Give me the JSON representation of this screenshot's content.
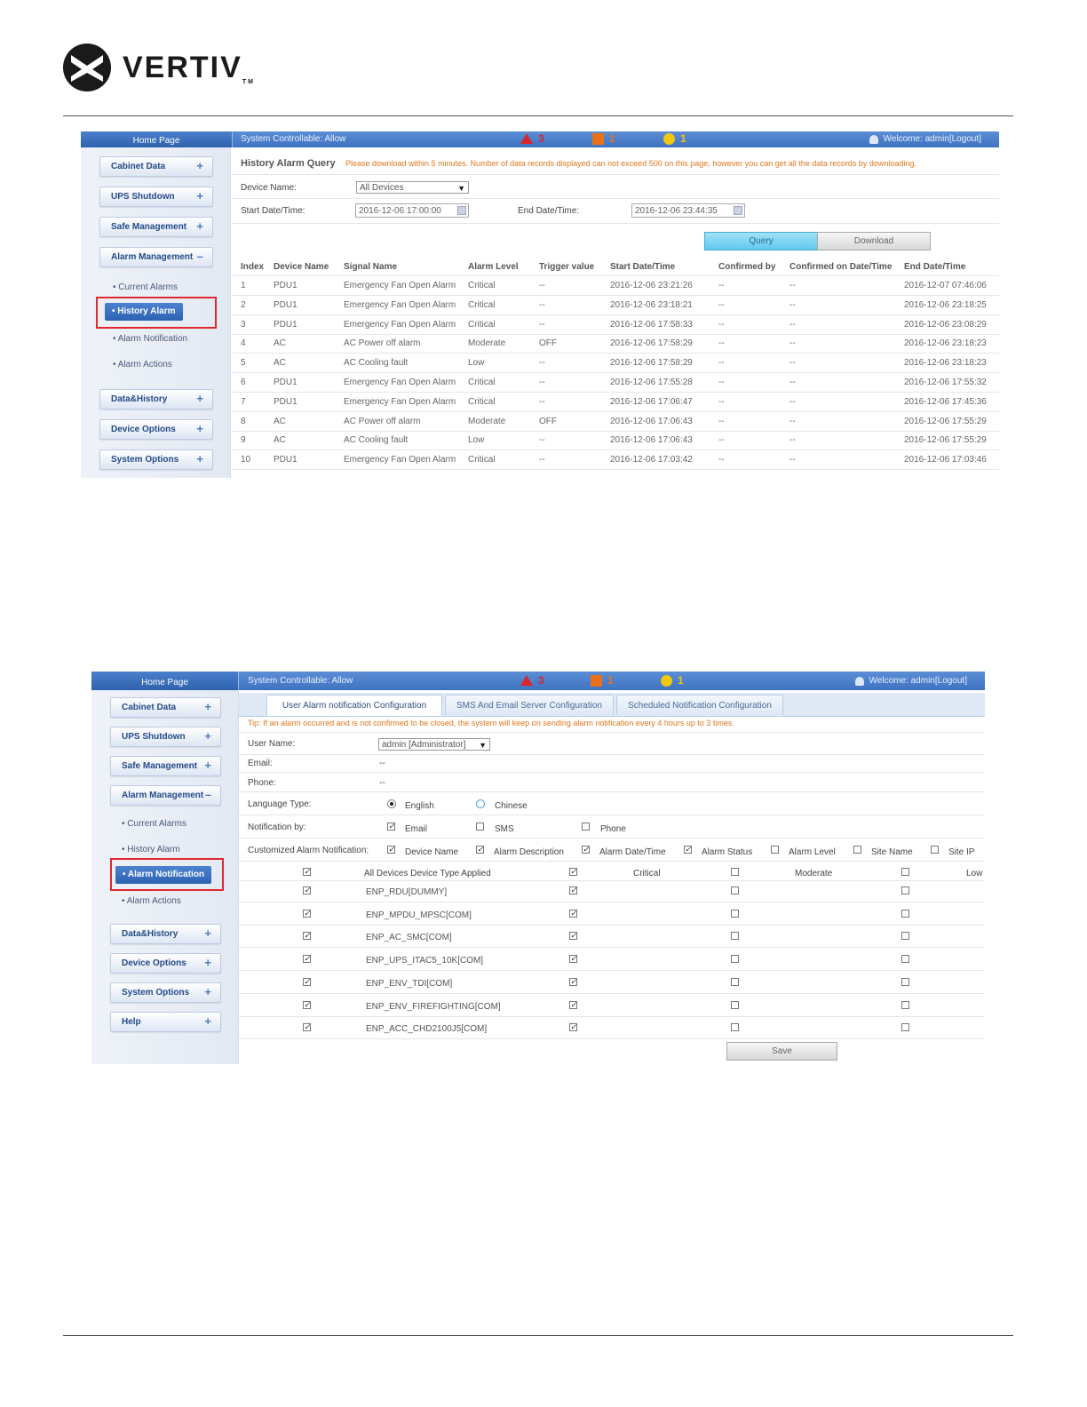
{
  "brand": {
    "name": "VERTIV",
    "tm": "TM"
  },
  "shot1": {
    "home": "Home Page",
    "system_controllable": "System Controllable:  Allow",
    "alarm_counts": {
      "critical": "3",
      "major": "1",
      "minor": "1"
    },
    "welcome": "Welcome: admin[Logout]",
    "nav": {
      "cabinet_data": "Cabinet Data",
      "ups_shutdown": "UPS Shutdown",
      "safe_management": "Safe Management",
      "alarm_management": "Alarm Management",
      "current_alarms": "Current Alarms",
      "history_alarm": "History Alarm",
      "alarm_notification": "Alarm Notification",
      "alarm_actions": "Alarm Actions",
      "data_history": "Data&History",
      "device_options": "Device Options",
      "system_options": "System Options"
    },
    "title": "History Alarm Query",
    "notice": "Please download within 5 minutes. Number of data records displayed can not exceed 500 on this page, however you can get all the data records by downloading.",
    "device_name_label": "Device Name:",
    "device_name_value": "All Devices",
    "start_label": "Start Date/Time:",
    "start_value": "2016-12-06 17:00:00",
    "end_label": "End Date/Time:",
    "end_value": "2016-12-06 23:44:35",
    "query": "Query",
    "download": "Download",
    "columns": [
      "Index",
      "Device Name",
      "Signal Name",
      "Alarm Level",
      "Trigger value",
      "Start Date/Time",
      "Confirmed by",
      "Confirmed on Date/Time",
      "End Date/Time"
    ],
    "rows": [
      [
        "1",
        "PDU1",
        "Emergency Fan Open Alarm",
        "Critical",
        "--",
        "2016-12-06 23:21:26",
        "--",
        "--",
        "2016-12-07 07:46:06"
      ],
      [
        "2",
        "PDU1",
        "Emergency Fan Open Alarm",
        "Critical",
        "--",
        "2016-12-06 23:18:21",
        "--",
        "--",
        "2016-12-06 23:18:25"
      ],
      [
        "3",
        "PDU1",
        "Emergency Fan Open Alarm",
        "Critical",
        "--",
        "2016-12-06 17:58:33",
        "--",
        "--",
        "2016-12-06 23:08:29"
      ],
      [
        "4",
        "AC",
        "AC Power off alarm",
        "Moderate",
        "OFF",
        "2016-12-06 17:58:29",
        "--",
        "--",
        "2016-12-06 23:18:23"
      ],
      [
        "5",
        "AC",
        "AC Cooling fault",
        "Low",
        "--",
        "2016-12-06 17:58:29",
        "--",
        "--",
        "2016-12-06 23:18:23"
      ],
      [
        "6",
        "PDU1",
        "Emergency Fan Open Alarm",
        "Critical",
        "--",
        "2016-12-06 17:55:28",
        "--",
        "--",
        "2016-12-06 17:55:32"
      ],
      [
        "7",
        "PDU1",
        "Emergency Fan Open Alarm",
        "Critical",
        "--",
        "2016-12-06 17:06:47",
        "--",
        "--",
        "2016-12-06 17:45:36"
      ],
      [
        "8",
        "AC",
        "AC Power off alarm",
        "Moderate",
        "OFF",
        "2016-12-06 17:06:43",
        "--",
        "--",
        "2016-12-06 17:55:29"
      ],
      [
        "9",
        "AC",
        "AC Cooling fault",
        "Low",
        "--",
        "2016-12-06 17:06:43",
        "--",
        "--",
        "2016-12-06 17:55:29"
      ],
      [
        "10",
        "PDU1",
        "Emergency Fan Open Alarm",
        "Critical",
        "--",
        "2016-12-06 17:03:42",
        "--",
        "--",
        "2016-12-06 17:03:46"
      ]
    ]
  },
  "shot2": {
    "home": "Home Page",
    "system_controllable": "System Controllable:  Allow",
    "alarm_counts": {
      "critical": "3",
      "major": "1",
      "minor": "1"
    },
    "welcome": "Welcome: admin[Logout]",
    "nav": {
      "cabinet_data": "Cabinet Data",
      "ups_shutdown": "UPS Shutdown",
      "safe_management": "Safe Management",
      "alarm_management": "Alarm Management",
      "current_alarms": "Current Alarms",
      "history_alarm": "History Alarm",
      "alarm_notification": "Alarm Notification",
      "alarm_actions": "Alarm Actions",
      "data_history": "Data&History",
      "device_options": "Device Options",
      "system_options": "System Options",
      "help": "Help"
    },
    "tabs": [
      "User Alarm notification Configuration",
      "SMS And Email Server Configuration",
      "Scheduled Notification Configuration"
    ],
    "tip": "Tip: If an alarm occurred and is not confirmed to be closed, the system will keep on sending alarm notification every 4 hours up to 3 times.",
    "user_name_label": "User Name:",
    "user_name_value": "admin [Administrator]",
    "email_label": "Email:",
    "email_value": "--",
    "phone_label": "Phone:",
    "phone_value": "--",
    "language_label": "Language Type:",
    "lang_english": "English",
    "lang_chinese": "Chinese",
    "notify_label": "Notification by:",
    "notify_email": "Email",
    "notify_sms": "SMS",
    "notify_phone": "Phone",
    "custom_label": "Customized Alarm Notification:",
    "custom_fields": [
      "Device Name",
      "Alarm Description",
      "Alarm Date/Time",
      "Alarm Status",
      "Alarm Level",
      "Site Name",
      "Site IP"
    ],
    "grid_header": {
      "devices": "All Devices Device Type Applied",
      "critical": "Critical",
      "moderate": "Moderate",
      "low": "Low"
    },
    "device_rows": [
      "ENP_RDU[DUMMY]",
      "ENP_MPDU_MPSC[COM]",
      "ENP_AC_SMC[COM]",
      "ENP_UPS_ITAC5_10K[COM]",
      "ENP_ENV_TDI[COM]",
      "ENP_ENV_FIREFIGHTING[COM]",
      "ENP_ACC_CHD2100J5[COM]"
    ],
    "save": "Save"
  }
}
